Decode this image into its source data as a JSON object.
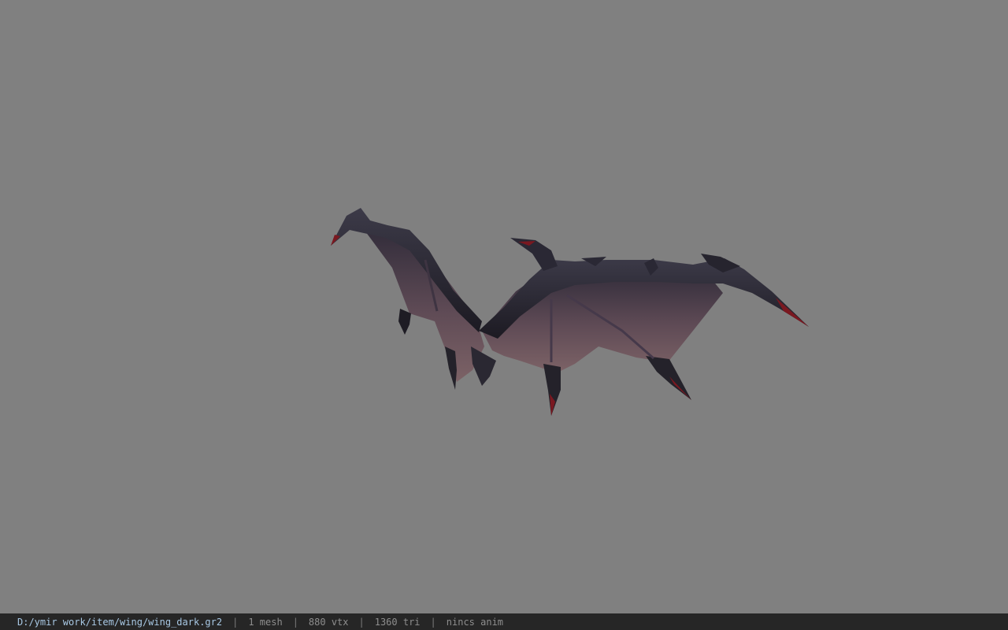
{
  "viewer": {
    "background_color": "#808080",
    "model_icon": "bat-wings-model"
  },
  "status": {
    "path": "D:/ymir work/item/wing/wing_dark.gr2",
    "separator": "|",
    "mesh": "1 mesh",
    "vtx": "880 vtx",
    "tri": "1360 tri",
    "anim": "nincs anim"
  }
}
